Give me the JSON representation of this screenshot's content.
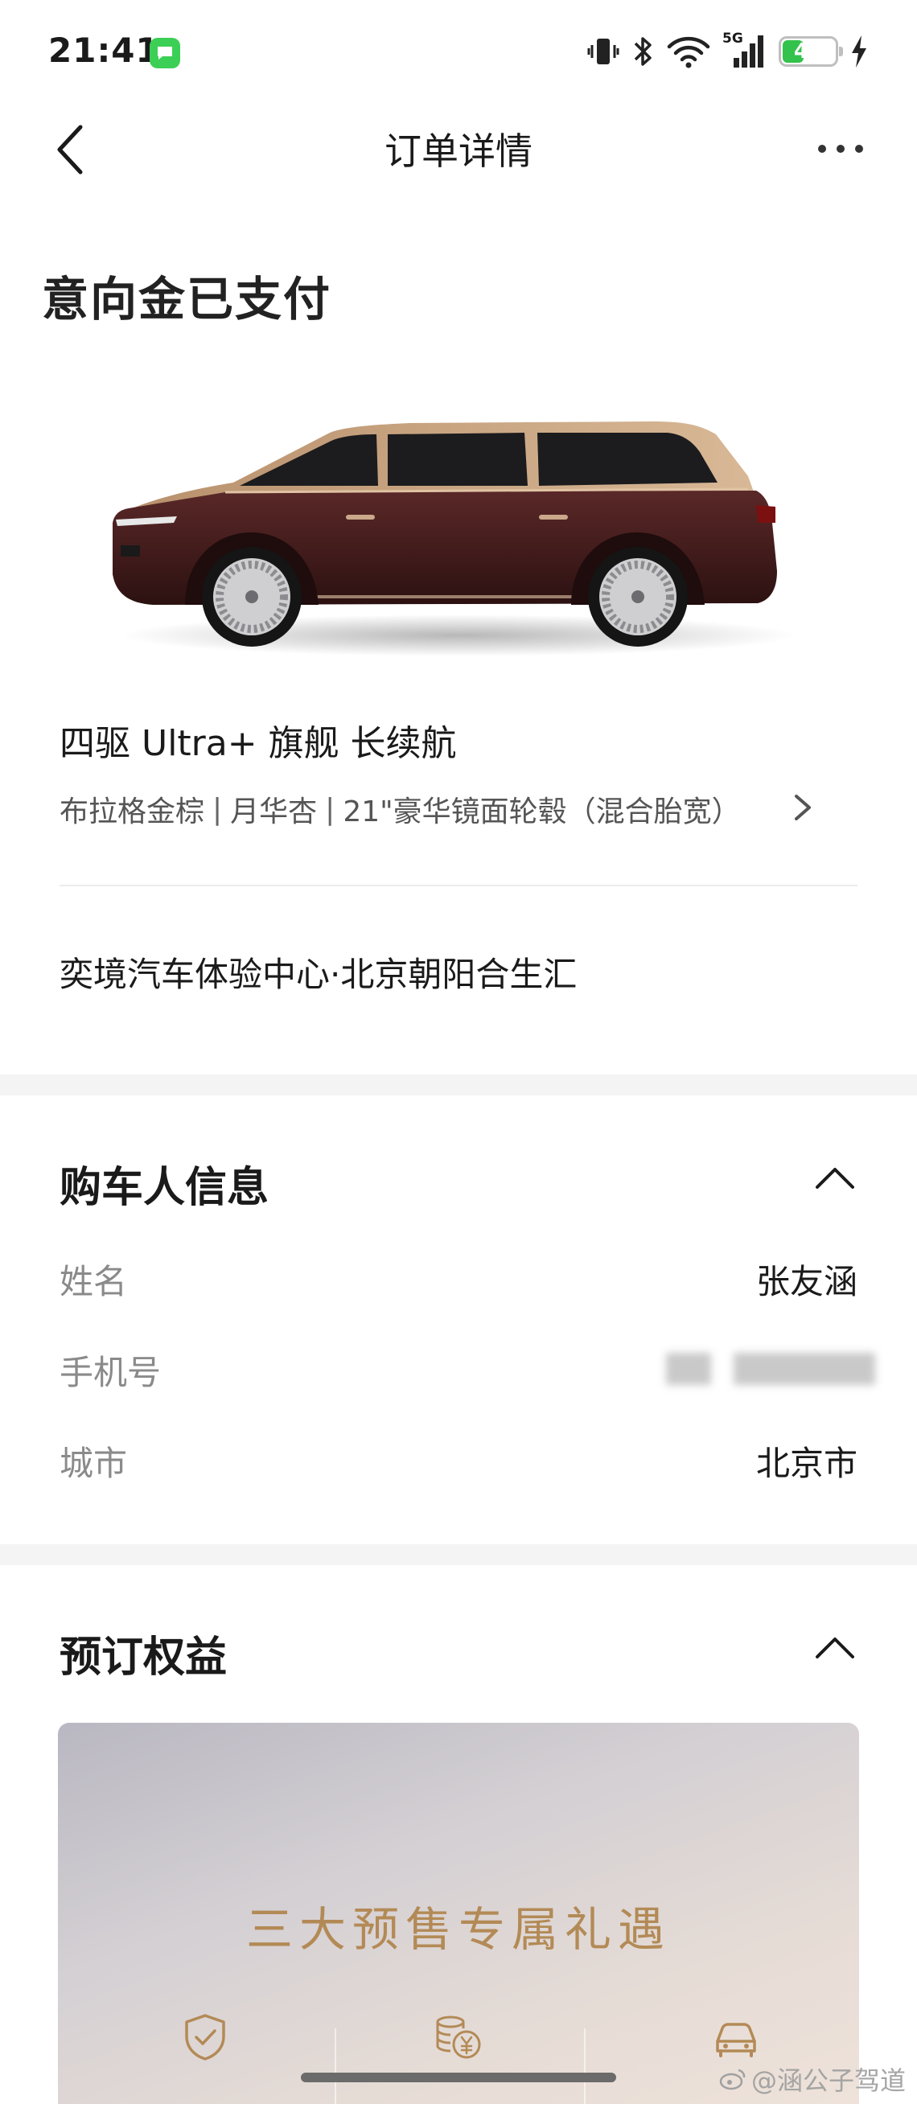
{
  "status_bar": {
    "time": "21:41",
    "network": "5G",
    "battery": "41",
    "battery_level": 0.41,
    "icons": [
      "message-app-icon",
      "vibrate-icon",
      "bluetooth-icon",
      "wifi-icon",
      "signal-5g-icon",
      "battery-icon",
      "charging-icon"
    ]
  },
  "nav": {
    "title": "订单详情",
    "back_icon": "chevron-left-icon",
    "more_icon": "more-dots-icon"
  },
  "order": {
    "status": "意向金已支付",
    "trim": "四驱 Ultra+ 旗舰 长续航",
    "options": [
      "布拉格金棕",
      "月华杏",
      "21\"豪华镜面轮毂（混合胎宽）"
    ],
    "options_separator": "|",
    "store": "奕境汽车体验中心·北京朝阳合生汇"
  },
  "buyer": {
    "title": "购车人信息",
    "rows": [
      {
        "label": "姓名",
        "value": "张友涵"
      },
      {
        "label": "手机号",
        "value": ""
      },
      {
        "label": "城市",
        "value": "北京市"
      }
    ]
  },
  "benefits": {
    "title": "预订权益",
    "card_title": "三大预售专属礼遇",
    "icons": [
      "shield-check-icon",
      "coins-yuan-icon",
      "car-icon"
    ]
  },
  "watermark": "@涵公子驾道",
  "colors": {
    "accent_gold": "#b38a56",
    "battery_green": "#33c24b",
    "car_body": "#4a1f1f",
    "car_roof": "#c49e7a"
  }
}
